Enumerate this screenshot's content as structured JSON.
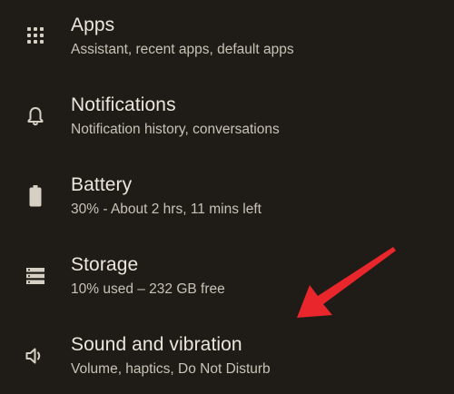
{
  "settings_list": [
    {
      "id": "apps",
      "icon": "apps-grid-icon",
      "title": "Apps",
      "subtitle": "Assistant, recent apps, default apps"
    },
    {
      "id": "notifications",
      "icon": "bell-icon",
      "title": "Notifications",
      "subtitle": "Notification history, conversations"
    },
    {
      "id": "battery",
      "icon": "battery-icon",
      "title": "Battery",
      "subtitle": "30% - About 2 hrs, 11 mins left"
    },
    {
      "id": "storage",
      "icon": "storage-icon",
      "title": "Storage",
      "subtitle": "10% used – 232 GB free"
    },
    {
      "id": "sound",
      "icon": "speaker-icon",
      "title": "Sound and vibration",
      "subtitle": "Volume, haptics, Do Not Disturb"
    }
  ],
  "colors": {
    "background": "#1f1c18",
    "title_text": "#ece6dc",
    "subtitle_text": "#c9c2b6",
    "icon": "#d6cfc3",
    "annotation_arrow": "#e8262b"
  }
}
